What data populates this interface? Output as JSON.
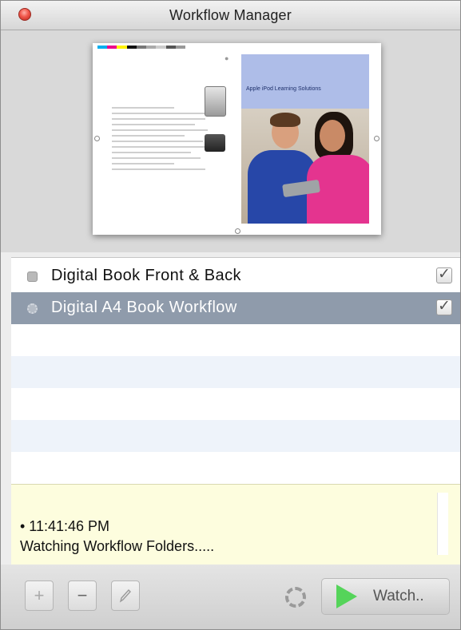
{
  "window": {
    "title": "Workflow Manager"
  },
  "preview": {
    "cover_title": "Apple iPod Learning Solutions"
  },
  "workflows": [
    {
      "label": "Digital Book Front & Back",
      "checked": true,
      "selected": false
    },
    {
      "label": "Digital A4 Book Workflow",
      "checked": true,
      "selected": true
    }
  ],
  "log": {
    "time": "• 11:41:46 PM",
    "status": "Watching Workflow Folders....."
  },
  "toolbar": {
    "add_label": "+",
    "remove_label": "−",
    "watch_label": "Watch.."
  },
  "icons": {
    "close": "close-icon",
    "edit": "pencil-icon",
    "spinner": "progress-spinner-icon",
    "play": "play-icon",
    "check": "checkmark-icon"
  },
  "colors": {
    "selection": "#8f9bab",
    "log_background": "#fdfdde",
    "play_green": "#55d45a",
    "close_red": "#f0564a"
  }
}
